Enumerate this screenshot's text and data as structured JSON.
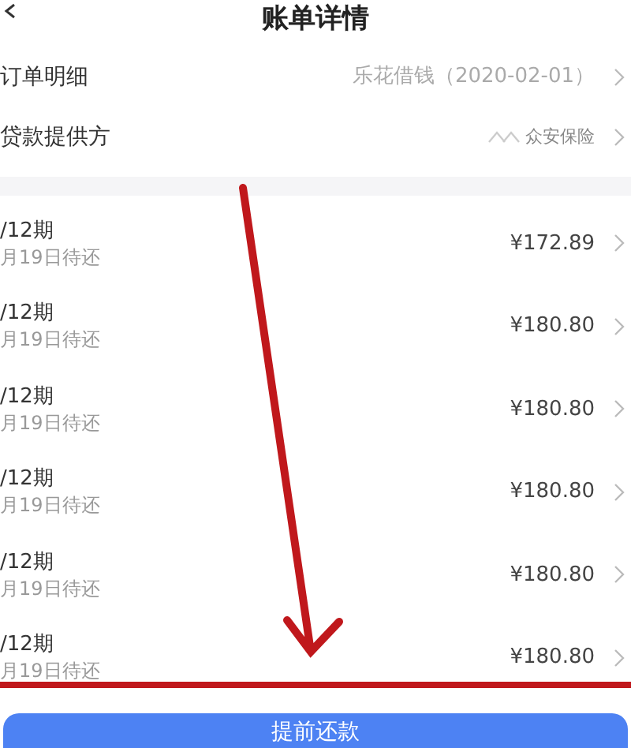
{
  "header": {
    "title": "账单详情"
  },
  "info_rows": [
    {
      "label": "订单明细",
      "value": "乐花借钱（2020-02-01）"
    },
    {
      "label": "贷款提供方",
      "value": "众安保险"
    }
  ],
  "installments": [
    {
      "period": "/12期",
      "due": "月19日待还",
      "amount": "¥172.89"
    },
    {
      "period": "/12期",
      "due": "月19日待还",
      "amount": "¥180.80"
    },
    {
      "period": "/12期",
      "due": "月19日待还",
      "amount": "¥180.80"
    },
    {
      "period": "/12期",
      "due": "月19日待还",
      "amount": "¥180.80"
    },
    {
      "period": "/12期",
      "due": "月19日待还",
      "amount": "¥180.80"
    },
    {
      "period": "/12期",
      "due": "月19日待还",
      "amount": "¥180.80"
    }
  ],
  "repay_button": "提前还款"
}
